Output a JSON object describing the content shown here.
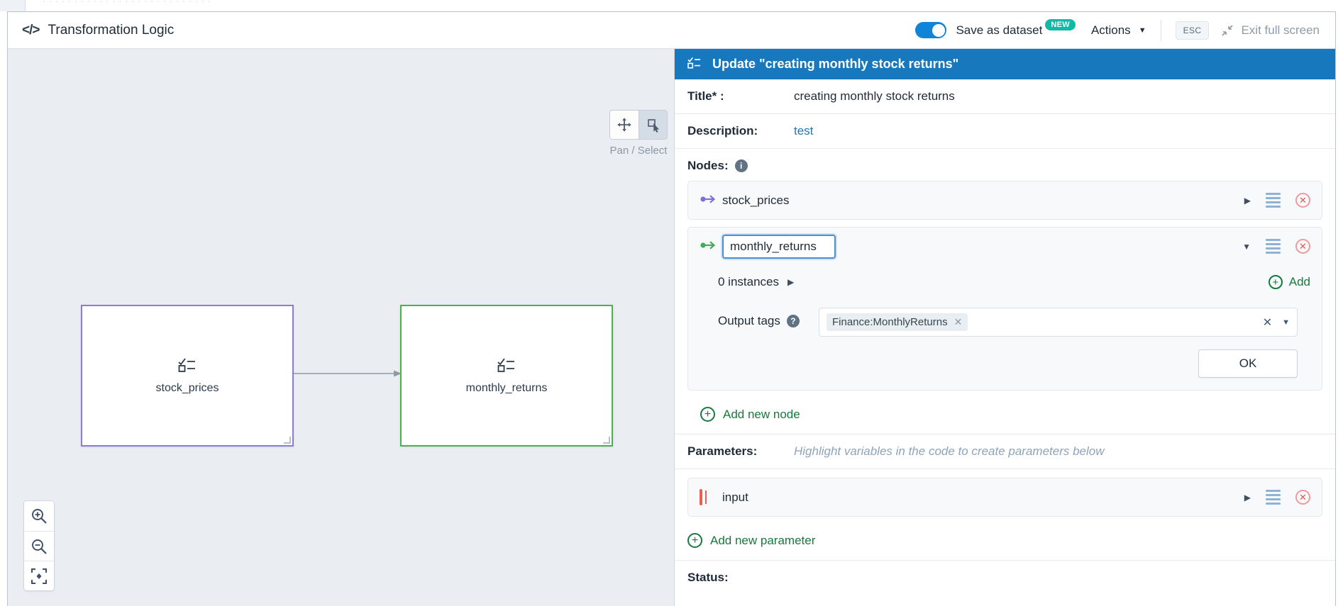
{
  "top_strip": {
    "ghost_text": "· · ·  ·  · · ·  · · · ·  ·  · · · · · · ·  · ·   · · · · · ·"
  },
  "header": {
    "title": "Transformation Logic",
    "code_icon": "</>",
    "save_as_dataset_label": "Save as dataset",
    "new_badge": "NEW",
    "actions_label": "Actions",
    "esc_key": "ESC",
    "exit_full_screen_label": "Exit full screen",
    "toggle_on": true
  },
  "canvas": {
    "pan_select_label": "Pan / Select",
    "pan_icon": "move-icon",
    "select_icon": "select-cursor-icon",
    "zoom_in_icon": "zoom-in-icon",
    "zoom_out_icon": "zoom-out-icon",
    "fit_icon": "fit-to-screen-icon",
    "nodes": [
      {
        "label": "stock_prices",
        "icon": "checklist-icon",
        "border_color": "#8b7cd8"
      },
      {
        "label": "monthly_returns",
        "icon": "checklist-icon",
        "border_color": "#4caf50"
      }
    ],
    "connector": "arrow-right"
  },
  "panel": {
    "title": "Update \"creating monthly stock returns\"",
    "title_icon": "checklist-icon",
    "title_bg": "#1878bd",
    "fields": {
      "title_label": "Title* :",
      "title_value": "creating monthly stock returns",
      "description_label": "Description:",
      "description_value": "test"
    },
    "nodes_section": {
      "label": "Nodes:",
      "info_icon": "info-icon",
      "rows": [
        {
          "name": "stock_prices",
          "lead_icon": "arrow-right-input-icon",
          "lead_color": "#7e6fd6",
          "expanded": false,
          "expand_icon": "triangle-right-icon",
          "menu_icon": "hamburger-icon",
          "delete_icon": "delete-circle-icon"
        },
        {
          "name": "monthly_returns",
          "lead_icon": "arrow-right-output-icon",
          "lead_color": "#3fae55",
          "expanded": true,
          "expand_icon": "triangle-down-icon",
          "menu_icon": "hamburger-icon",
          "delete_icon": "delete-circle-icon",
          "instances_label": "0 instances",
          "instances_expand_icon": "triangle-right-icon",
          "add_label": "Add",
          "add_icon": "plus-circle-icon",
          "output_tags_label": "Output tags",
          "output_tags_help_icon": "question-icon",
          "tags": [
            {
              "label": "Finance:MonthlyReturns",
              "remove_icon": "x-icon"
            }
          ],
          "tags_clear_icon": "x-icon",
          "tags_dropdown_icon": "chevron-down-icon",
          "ok_label": "OK"
        }
      ],
      "add_new_node_label": "Add new node",
      "add_new_node_icon": "plus-circle-icon"
    },
    "parameters_section": {
      "label": "Parameters:",
      "hint": "Highlight variables in the code to create parameters below",
      "rows": [
        {
          "name": "input",
          "lead_icon": "table-grid-icon",
          "expand_icon": "triangle-right-icon",
          "menu_icon": "hamburger-icon",
          "delete_icon": "delete-circle-icon"
        }
      ],
      "add_new_parameter_label": "Add new parameter",
      "add_new_parameter_icon": "plus-circle-icon"
    },
    "status_label": "Status:"
  }
}
